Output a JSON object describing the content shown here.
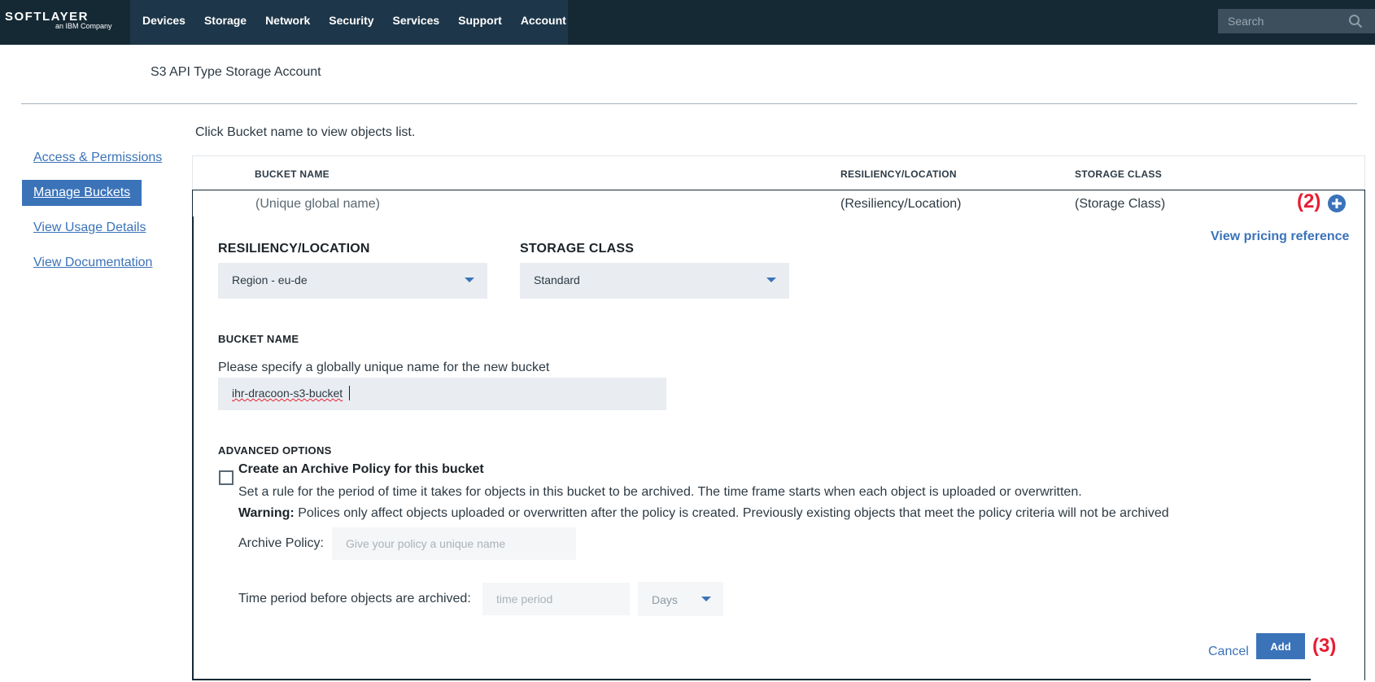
{
  "brand": {
    "name": "SOFTLAYER",
    "tagline": "an IBM Company"
  },
  "nav": {
    "items": [
      "Devices",
      "Storage",
      "Network",
      "Security",
      "Services",
      "Support",
      "Account"
    ]
  },
  "search": {
    "placeholder": "Search"
  },
  "page": {
    "title": "S3 API Type Storage Account",
    "instruction": "Click Bucket name to view objects list."
  },
  "sidebar": {
    "items": [
      {
        "label": "Access & Permissions",
        "active": false
      },
      {
        "label": "Manage Buckets",
        "active": true
      },
      {
        "label": "View Usage Details",
        "active": false
      },
      {
        "label": "View Documentation",
        "active": false
      }
    ]
  },
  "table": {
    "headers": [
      "BUCKET NAME",
      "RESILIENCY/LOCATION",
      "STORAGE CLASS"
    ],
    "new_row": [
      "(Unique global name)",
      "(Resiliency/Location)",
      "(Storage Class)"
    ]
  },
  "annotations": {
    "plus": "(2)",
    "add": "(3)"
  },
  "form": {
    "pricing_link": "View pricing reference",
    "resiliency_label": "RESILIENCY/LOCATION",
    "resiliency_value": "Region - eu-de",
    "storage_class_label": "STORAGE CLASS",
    "storage_class_value": "Standard",
    "bucket_name_label": "BUCKET NAME",
    "bucket_name_help": "Please specify a globally unique name for the new bucket",
    "bucket_name_value": "ihr-dracoon-s3-bucket",
    "advanced_label": "ADVANCED OPTIONS",
    "archive_title": "Create an Archive Policy for this bucket",
    "archive_desc": "Set a rule for the period of time it takes for objects in this bucket to be archived. The time frame starts when each object is uploaded or overwritten.",
    "warning_label": "Warning:",
    "warning_text": "Polices only affect objects uploaded or overwritten after the policy is created. Previously existing objects that meet the policy criteria will not be archived",
    "archive_policy_label": "Archive Policy:",
    "archive_policy_placeholder": "Give your policy a unique name",
    "time_period_label": "Time period before objects are archived:",
    "time_period_placeholder": "time period",
    "time_unit_value": "Days",
    "cancel_label": "Cancel",
    "add_label": "Add"
  },
  "colors": {
    "nav_bg": "#152935",
    "accent": "#3b73b9",
    "annotation": "#e71d32"
  }
}
